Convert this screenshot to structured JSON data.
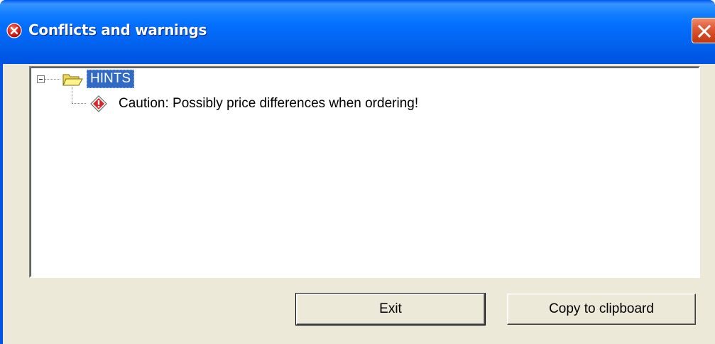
{
  "window": {
    "title": "Conflicts and warnings",
    "title_icon": "error-icon",
    "close_icon": "close-icon"
  },
  "tree": {
    "root": {
      "label": "HINTS",
      "icon": "folder-open-icon",
      "expanded": true,
      "selected": true
    },
    "children": [
      {
        "label": "Caution: Possibly price differences when ordering!",
        "icon": "warning-diamond-icon"
      }
    ]
  },
  "buttons": {
    "exit_label": "Exit",
    "copy_label": "Copy to clipboard"
  },
  "colors": {
    "titlebar": "#0054e3",
    "selection": "#316ac5",
    "dialog_face": "#ece9d8",
    "close_button": "#e0603c"
  }
}
